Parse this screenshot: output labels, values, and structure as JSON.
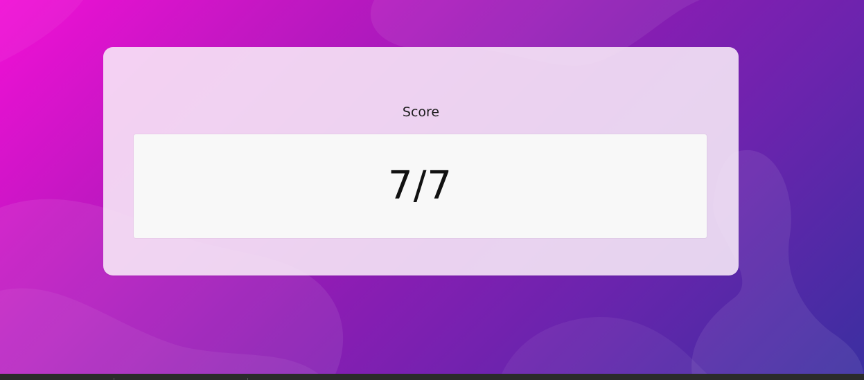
{
  "score": {
    "label": "Score",
    "value": "7/7"
  },
  "colors": {
    "gradient_start": "#f20fd6",
    "gradient_mid": "#8a1db3",
    "gradient_end": "#3a2fa0",
    "card_background": "#f8ecf8",
    "score_box_background": "#f8f8f8",
    "taskbar": "#2b2b2b"
  }
}
